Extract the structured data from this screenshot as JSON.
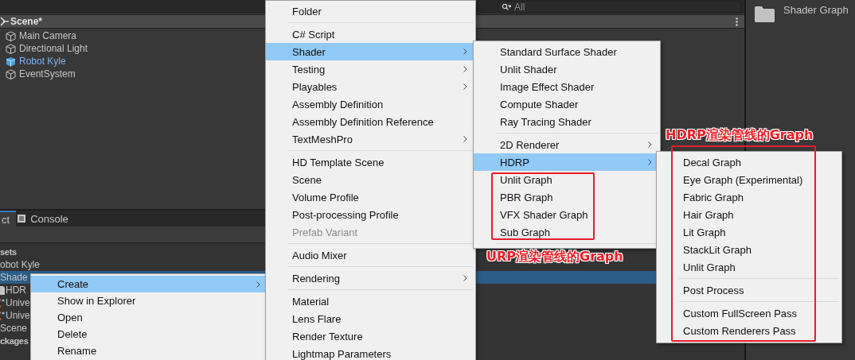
{
  "hierarchy": {
    "search": {
      "placeholder": "All"
    },
    "scene": "Scene*",
    "items": [
      {
        "label": "Main Camera",
        "kind": "object"
      },
      {
        "label": "Directional Light",
        "kind": "object"
      },
      {
        "label": "Robot Kyle",
        "kind": "prefab"
      },
      {
        "label": "EventSystem",
        "kind": "object"
      }
    ]
  },
  "inspector": {
    "folder": "Shader Graph"
  },
  "project": {
    "tabs": [
      {
        "label": "ct",
        "selected": true
      },
      {
        "label": "Console",
        "selected": false
      }
    ],
    "tree": [
      {
        "label": "sets",
        "kind": "heading",
        "selected": false
      },
      {
        "label": "obot Kyle",
        "kind": "folder",
        "selected": false
      },
      {
        "label": "Shade",
        "kind": "folder",
        "selected": true
      },
      {
        "label": "HDR",
        "kind": "asset",
        "selected": false
      },
      {
        "label": "Unive",
        "kind": "code",
        "selected": false
      },
      {
        "label": "Unive",
        "kind": "code",
        "selected": false
      },
      {
        "label": "Scene",
        "kind": "folder",
        "selected": false
      },
      {
        "label": "ckages",
        "kind": "heading",
        "selected": false
      }
    ]
  },
  "context_menu": {
    "items": [
      {
        "kind": "item",
        "label": "Create",
        "submenu": true,
        "selected": true,
        "disabled": false
      },
      {
        "kind": "item",
        "label": "Show in Explorer",
        "submenu": false,
        "selected": false,
        "disabled": false
      },
      {
        "kind": "item",
        "label": "Open",
        "submenu": false,
        "selected": false,
        "disabled": false
      },
      {
        "kind": "item",
        "label": "Delete",
        "submenu": false,
        "selected": false,
        "disabled": false
      },
      {
        "kind": "item",
        "label": "Rename",
        "submenu": false,
        "selected": false,
        "disabled": false
      }
    ]
  },
  "menus": [
    {
      "items": [
        {
          "kind": "item",
          "label": "Folder",
          "submenu": false,
          "selected": false,
          "disabled": false
        },
        {
          "kind": "separator"
        },
        {
          "kind": "item",
          "label": "C# Script",
          "submenu": false,
          "selected": false,
          "disabled": false
        },
        {
          "kind": "item",
          "label": "Shader",
          "submenu": true,
          "selected": true,
          "disabled": false
        },
        {
          "kind": "item",
          "label": "Testing",
          "submenu": true,
          "selected": false,
          "disabled": false
        },
        {
          "kind": "item",
          "label": "Playables",
          "submenu": true,
          "selected": false,
          "disabled": false
        },
        {
          "kind": "item",
          "label": "Assembly Definition",
          "submenu": false,
          "selected": false,
          "disabled": false
        },
        {
          "kind": "item",
          "label": "Assembly Definition Reference",
          "submenu": false,
          "selected": false,
          "disabled": false
        },
        {
          "kind": "item",
          "label": "TextMeshPro",
          "submenu": true,
          "selected": false,
          "disabled": false
        },
        {
          "kind": "separator"
        },
        {
          "kind": "item",
          "label": "HD Template Scene",
          "submenu": false,
          "selected": false,
          "disabled": false
        },
        {
          "kind": "item",
          "label": "Scene",
          "submenu": false,
          "selected": false,
          "disabled": false
        },
        {
          "kind": "item",
          "label": "Volume Profile",
          "submenu": false,
          "selected": false,
          "disabled": false
        },
        {
          "kind": "item",
          "label": "Post-processing Profile",
          "submenu": false,
          "selected": false,
          "disabled": false
        },
        {
          "kind": "item",
          "label": "Prefab Variant",
          "submenu": false,
          "selected": false,
          "disabled": true
        },
        {
          "kind": "separator"
        },
        {
          "kind": "item",
          "label": "Audio Mixer",
          "submenu": false,
          "selected": false,
          "disabled": false
        },
        {
          "kind": "separator"
        },
        {
          "kind": "item",
          "label": "Rendering",
          "submenu": true,
          "selected": false,
          "disabled": false
        },
        {
          "kind": "separator"
        },
        {
          "kind": "item",
          "label": "Material",
          "submenu": false,
          "selected": false,
          "disabled": false
        },
        {
          "kind": "item",
          "label": "Lens Flare",
          "submenu": false,
          "selected": false,
          "disabled": false
        },
        {
          "kind": "item",
          "label": "Render Texture",
          "submenu": false,
          "selected": false,
          "disabled": false
        },
        {
          "kind": "item",
          "label": "Lightmap Parameters",
          "submenu": false,
          "selected": false,
          "disabled": false
        }
      ]
    },
    {
      "items": [
        {
          "kind": "item",
          "label": "Standard Surface Shader",
          "submenu": false,
          "selected": false,
          "disabled": false
        },
        {
          "kind": "item",
          "label": "Unlit Shader",
          "submenu": false,
          "selected": false,
          "disabled": false
        },
        {
          "kind": "item",
          "label": "Image Effect Shader",
          "submenu": false,
          "selected": false,
          "disabled": false
        },
        {
          "kind": "item",
          "label": "Compute Shader",
          "submenu": false,
          "selected": false,
          "disabled": false
        },
        {
          "kind": "item",
          "label": "Ray Tracing Shader",
          "submenu": false,
          "selected": false,
          "disabled": false
        },
        {
          "kind": "separator"
        },
        {
          "kind": "item",
          "label": "2D Renderer",
          "submenu": true,
          "selected": false,
          "disabled": false
        },
        {
          "kind": "item",
          "label": "HDRP",
          "submenu": true,
          "selected": true,
          "disabled": false
        },
        {
          "kind": "item",
          "label": "Unlit Graph",
          "submenu": false,
          "selected": false,
          "disabled": false
        },
        {
          "kind": "item",
          "label": "PBR Graph",
          "submenu": false,
          "selected": false,
          "disabled": false
        },
        {
          "kind": "item",
          "label": "VFX Shader Graph",
          "submenu": false,
          "selected": false,
          "disabled": false
        },
        {
          "kind": "item",
          "label": "Sub Graph",
          "submenu": false,
          "selected": false,
          "disabled": false
        },
        {
          "kind": "separator"
        }
      ]
    },
    {
      "items": [
        {
          "kind": "item",
          "label": "Decal Graph",
          "submenu": false,
          "selected": false,
          "disabled": false
        },
        {
          "kind": "item",
          "label": "Eye Graph (Experimental)",
          "submenu": false,
          "selected": false,
          "disabled": false
        },
        {
          "kind": "item",
          "label": "Fabric Graph",
          "submenu": false,
          "selected": false,
          "disabled": false
        },
        {
          "kind": "item",
          "label": "Hair Graph",
          "submenu": false,
          "selected": false,
          "disabled": false
        },
        {
          "kind": "item",
          "label": "Lit Graph",
          "submenu": false,
          "selected": false,
          "disabled": false
        },
        {
          "kind": "item",
          "label": "StackLit Graph",
          "submenu": false,
          "selected": false,
          "disabled": false
        },
        {
          "kind": "item",
          "label": "Unlit Graph",
          "submenu": false,
          "selected": false,
          "disabled": false
        },
        {
          "kind": "separator"
        },
        {
          "kind": "item",
          "label": "Post Process",
          "submenu": false,
          "selected": false,
          "disabled": false
        },
        {
          "kind": "separator"
        },
        {
          "kind": "item",
          "label": "Custom FullScreen Pass",
          "submenu": false,
          "selected": false,
          "disabled": false
        },
        {
          "kind": "item",
          "label": "Custom Renderers Pass",
          "submenu": false,
          "selected": false,
          "disabled": false
        }
      ]
    }
  ],
  "annotations": [
    {
      "label": "URP渲染管线的Graph"
    },
    {
      "label": "HDRP渲染管线的Graph"
    }
  ]
}
